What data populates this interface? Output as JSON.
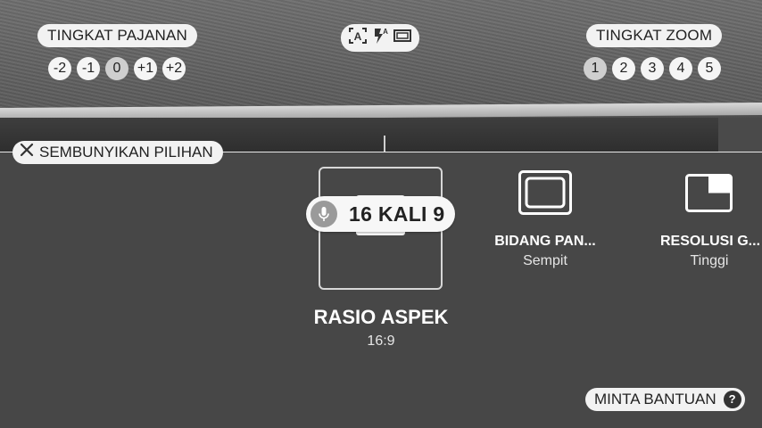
{
  "exposure": {
    "label": "TINGKAT PAJANAN",
    "levels": [
      "-2",
      "-1",
      "0",
      "+1",
      "+2"
    ],
    "selected": "0"
  },
  "zoom": {
    "label": "TINGKAT ZOOM",
    "levels": [
      "1",
      "2",
      "3",
      "4",
      "5"
    ],
    "selected": "1"
  },
  "quick_icons": [
    "auto-mode-icon",
    "flash-auto-icon",
    "aspect-frame-icon"
  ],
  "hide_options": {
    "label": "SEMBUNYIKAN PILIHAN"
  },
  "voice_hint": {
    "text": "16 KALI 9"
  },
  "options": [
    {
      "title": "RASIO ASPEK",
      "value": "16:9",
      "icon": "aspect-ratio-icon"
    },
    {
      "title": "BIDANG PAN...",
      "value": "Sempit",
      "icon": "field-of-view-icon"
    },
    {
      "title": "RESOLUSI G...",
      "value": "Tinggi",
      "icon": "resolution-icon"
    }
  ],
  "help": {
    "label": "MINTA BANTUAN",
    "icon_glyph": "?"
  }
}
